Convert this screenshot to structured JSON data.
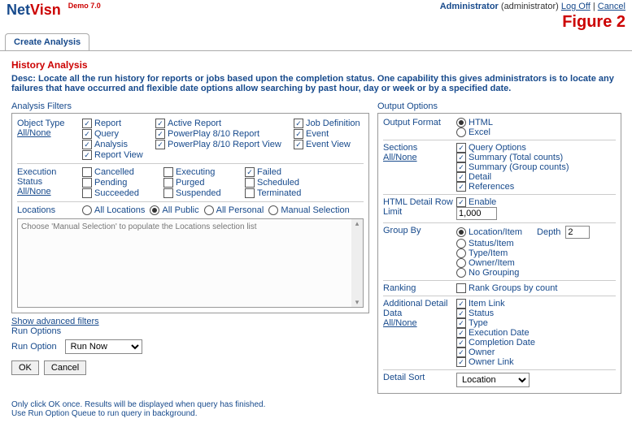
{
  "header": {
    "logo_net": "Net",
    "logo_visn": "Visn",
    "version": "Demo 7.0",
    "admin_role": "Administrator",
    "admin_user": "(administrator)",
    "logoff": "Log Off",
    "sep": " | ",
    "cancel": "Cancel",
    "figure": "Figure 2"
  },
  "tab": {
    "label": "Create Analysis"
  },
  "titles": {
    "heading": "History Analysis",
    "desc_label": "Desc: ",
    "desc_text": "Locate all the run history for reports or jobs based upon the completion status. One capability this gives administrators is to locate any failures that have occurred and flexible date options allow searching by past hour, day or week or by a specified date.",
    "filters": "Analysis Filters",
    "output": "Output Options"
  },
  "filters": {
    "object_type_label": "Object Type",
    "all_none": "All/None",
    "ot_report": "Report",
    "ot_query": "Query",
    "ot_analysis": "Analysis",
    "ot_reportview": "Report View",
    "ot_activereport": "Active Report",
    "ot_pp810r": "PowerPlay 8/10 Report",
    "ot_pp810rv": "PowerPlay 8/10 Report View",
    "ot_jobdef": "Job Definition",
    "ot_event": "Event",
    "ot_eventview": "Event View",
    "exec_label": "Execution Status",
    "es_cancelled": "Cancelled",
    "es_pending": "Pending",
    "es_succeeded": "Succeeded",
    "es_executing": "Executing",
    "es_purged": "Purged",
    "es_suspended": "Suspended",
    "es_failed": "Failed",
    "es_scheduled": "Scheduled",
    "es_terminated": "Terminated",
    "loc_label": "Locations",
    "loc_all": "All Locations",
    "loc_public": "All Public",
    "loc_personal": "All Personal",
    "loc_manual": "Manual Selection",
    "loc_placeholder": "Choose 'Manual Selection' to populate the Locations selection list",
    "adv": "Show advanced filters",
    "run_options": "Run Options",
    "run_option_label": "Run Option",
    "run_option_value": "Run Now",
    "ok": "OK",
    "cancel": "Cancel"
  },
  "output": {
    "format_label": "Output Format",
    "fmt_html": "HTML",
    "fmt_excel": "Excel",
    "sections_label": "Sections",
    "all_none": "All/None",
    "sec_query": "Query Options",
    "sec_sumtot": "Summary (Total counts)",
    "sec_sumgrp": "Summary (Group counts)",
    "sec_detail": "Detail",
    "sec_refs": "References",
    "htmlrow_label": "HTML Detail Row Limit",
    "enable": "Enable",
    "limit_val": "1,000",
    "groupby_label": "Group By",
    "gb_loc": "Location/Item",
    "gb_status": "Status/Item",
    "gb_type": "Type/Item",
    "gb_owner": "Owner/Item",
    "gb_none": "No Grouping",
    "depth_label": "Depth",
    "depth_val": "2",
    "ranking_label": "Ranking",
    "rank_opt": "Rank Groups by count",
    "add_label": "Additional Detail Data",
    "ad_itemlink": "Item Link",
    "ad_status": "Status",
    "ad_type": "Type",
    "ad_execdate": "Execution Date",
    "ad_compdate": "Completion Date",
    "ad_owner": "Owner",
    "ad_ownerlink": "Owner Link",
    "sort_label": "Detail Sort",
    "sort_val": "Location"
  },
  "footer": {
    "l1": "Only click OK once. Results will be displayed when query has finished.",
    "l2": "Use Run Option Queue to run query in background."
  }
}
